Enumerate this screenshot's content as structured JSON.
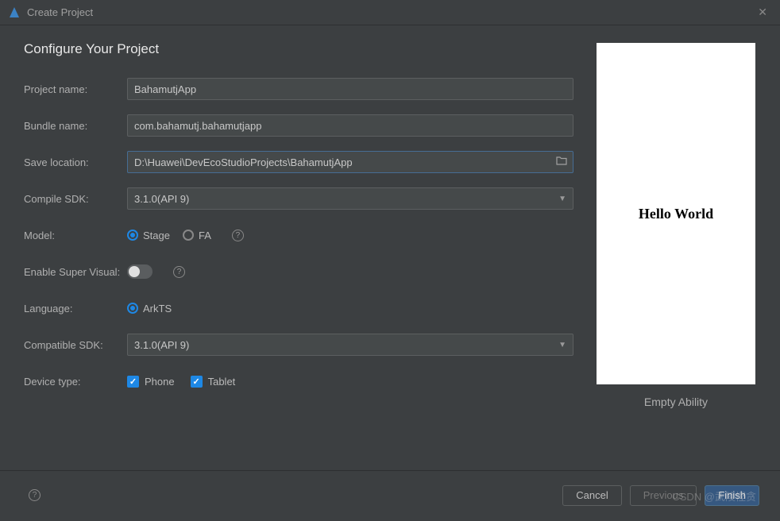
{
  "title": "Create Project",
  "heading": "Configure Your Project",
  "labels": {
    "projectName": "Project name:",
    "bundleName": "Bundle name:",
    "saveLocation": "Save location:",
    "compileSdk": "Compile SDK:",
    "model": "Model:",
    "enableSuperVisual": "Enable Super Visual:",
    "language": "Language:",
    "compatibleSdk": "Compatible SDK:",
    "deviceType": "Device type:"
  },
  "values": {
    "projectName": "BahamutjApp",
    "bundleName": "com.bahamutj.bahamutjapp",
    "saveLocation": "D:\\Huawei\\DevEcoStudioProjects\\BahamutjApp",
    "compileSdk": "3.1.0(API 9)",
    "compatibleSdk": "3.1.0(API 9)"
  },
  "model": {
    "stage": "Stage",
    "fa": "FA"
  },
  "language": {
    "arkts": "ArkTS"
  },
  "deviceType": {
    "phone": "Phone",
    "tablet": "Tablet"
  },
  "preview": {
    "text": "Hello World",
    "caption": "Empty Ability"
  },
  "buttons": {
    "cancel": "Cancel",
    "previous": "Previous",
    "finish": "Finish"
  },
  "watermark": "CSDN @武陵悭贪"
}
